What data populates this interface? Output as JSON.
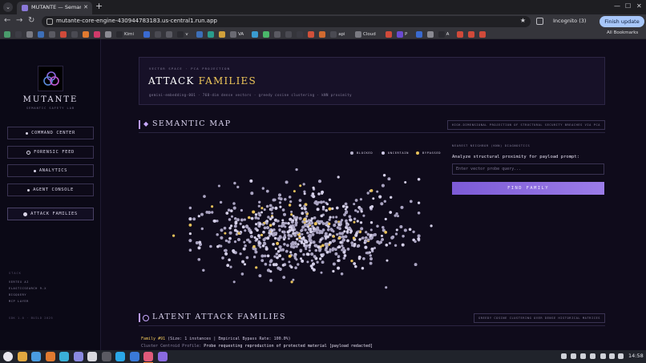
{
  "browser": {
    "tab_title": "MUTANTE — Semantic Safe",
    "tab_close": "✕",
    "new_tab": "+",
    "url": "mutante-core-engine-430944783183.us-central1.run.app",
    "profile": "Incognito (3)",
    "update_button": "Finish update",
    "all_bookmarks": "All Bookmarks",
    "bookmarks": [
      {
        "label": "",
        "color": "#4a9c6c"
      },
      {
        "label": "",
        "color": "#3d3d45"
      },
      {
        "label": "",
        "color": "#7a7a82"
      },
      {
        "label": "",
        "color": "#3d6fb8"
      },
      {
        "label": "",
        "color": "#5a5a62"
      },
      {
        "label": "",
        "color": "#d04a3a"
      },
      {
        "label": "",
        "color": "#4a4a52"
      },
      {
        "label": "",
        "color": "#e07a30"
      },
      {
        "label": "",
        "color": "#d03a6a"
      },
      {
        "label": "",
        "color": "#8a8a92"
      },
      {
        "label": "Kimi",
        "color": "#2a2a30"
      },
      {
        "label": "",
        "color": "#3a6ad0"
      },
      {
        "label": "",
        "color": "#4a4a52"
      },
      {
        "label": "",
        "color": "#5a5a62"
      },
      {
        "label": "v",
        "color": "#2a2a30"
      },
      {
        "label": "",
        "color": "#3d6fb8"
      },
      {
        "label": "",
        "color": "#2a9c8c"
      },
      {
        "label": "",
        "color": "#d0a03a"
      },
      {
        "label": "VA",
        "color": "#6a6a72"
      },
      {
        "label": "",
        "color": "#3a9cd0"
      },
      {
        "label": "",
        "color": "#4ab86a"
      },
      {
        "label": "",
        "color": "#5a5a62"
      },
      {
        "label": "",
        "color": "#4a4a52"
      },
      {
        "label": "",
        "color": "#3a3a42"
      },
      {
        "label": "",
        "color": "#d0503a"
      },
      {
        "label": "",
        "color": "#d06a30"
      },
      {
        "label": "api",
        "color": "#4a4a52"
      },
      {
        "label": "Cloud",
        "color": "#7a7a82"
      },
      {
        "label": "",
        "color": "#d04a3a"
      },
      {
        "label": "P",
        "color": "#6a4ad0"
      },
      {
        "label": "",
        "color": "#3a6ad0"
      },
      {
        "label": "",
        "color": "#8a8a92"
      },
      {
        "label": "A",
        "color": "#2a2a30"
      },
      {
        "label": "",
        "color": "#d04a3a"
      },
      {
        "label": "",
        "color": "#d04a3a"
      },
      {
        "label": "",
        "color": "#d04a3a"
      }
    ]
  },
  "sidebar": {
    "brand": "MUTANTE",
    "brand_sub": "SEMANTIC SAFETY LAB",
    "nav": [
      {
        "label": "COMMAND CENTER",
        "icon": "dot-icon"
      },
      {
        "label": "FORENSIC FEED",
        "icon": "ring-icon"
      },
      {
        "label": "ANALYTICS",
        "icon": "dot-icon"
      },
      {
        "label": "AGENT CONSOLE",
        "icon": "dot-icon"
      },
      {
        "label": "ATTACK FAMILIES",
        "icon": "filled-dot-icon",
        "active": true
      }
    ],
    "stack_label": "STACK",
    "stack": [
      "VERTEX AI",
      "ELASTICSEARCH 9.X",
      "BIGQUERY",
      "MCP LAYER"
    ],
    "version": "SDK 1.0 · BUILD 2025"
  },
  "header": {
    "kicker": "VECTOR SPACE · PCA PROJECTION",
    "title_a": "ATTACK",
    "title_b": "FAMILIES",
    "subtitle": "gemini-embedding-001 · 768-dim dense vectors · greedy cosine clustering · kNN proximity"
  },
  "semantic_map": {
    "title": "SEMANTIC MAP",
    "tag": "HIGH-DIMENSIONAL PROJECTION OF STRUCTURAL SECURITY BREACHES VIA PCA"
  },
  "legend": [
    {
      "label": "BLOCKED",
      "color": "#b7b2cc"
    },
    {
      "label": "UNCERTAIN",
      "color": "#cfc9e6"
    },
    {
      "label": "BYPASSED",
      "color": "#e8c25a"
    }
  ],
  "knn": {
    "kicker": "NEAREST NEIGHBOR (KNN) DIAGNOSTICS",
    "prompt": "Analyze structural proximity for payload prompt:",
    "placeholder": "Enter vector probe query...",
    "button": "FIND FAMILY"
  },
  "latent": {
    "title": "LATENT ATTACK FAMILIES",
    "tag": "GREEDY COSINE CLUSTERING OVER DENSE HISTORICAL MATRICES",
    "family_id": "Family #91",
    "family_meta": "(Size: 1 instances | Empirical Bypass Rate: 100.0%)",
    "centroid_label": "Cluster Centroid Profile:",
    "centroid_text": "Probe requesting reproduction of protected material [payload redacted]"
  },
  "taskbar": {
    "clock": "14:58",
    "apps": [
      "#e8e8ee",
      "#e0a840",
      "#4a9ce0",
      "#e07a30",
      "#3ab0d8",
      "#8a8ae0",
      "#d8d8de",
      "#5a5a62",
      "#2aa8e8",
      "#3a7ad8",
      "#e05a7a",
      "#8a6ae0"
    ]
  },
  "chart_data": {
    "type": "scatter",
    "title": "",
    "xlabel": "",
    "ylabel": "",
    "n_points": 720,
    "series": [
      {
        "name": "BLOCKED",
        "color": "#aaa4c2"
      },
      {
        "name": "UNCERTAIN",
        "color": "#d4cfe8"
      },
      {
        "name": "BYPASSED",
        "color": "#e8c25a"
      }
    ],
    "composition": {
      "BLOCKED": 0.6,
      "UNCERTAIN": 0.34,
      "BYPASSED": 0.06
    },
    "center": [
      0,
      0
    ],
    "spread": [
      1,
      0.42
    ],
    "outliers": [
      [
        -1.55,
        -0.05
      ],
      [
        1.5,
        0.1
      ],
      [
        -1.25,
        0.25
      ],
      [
        0.4,
        0.85
      ],
      [
        -0.4,
        -0.6
      ]
    ],
    "grid": false,
    "legend_position": "top-right"
  }
}
